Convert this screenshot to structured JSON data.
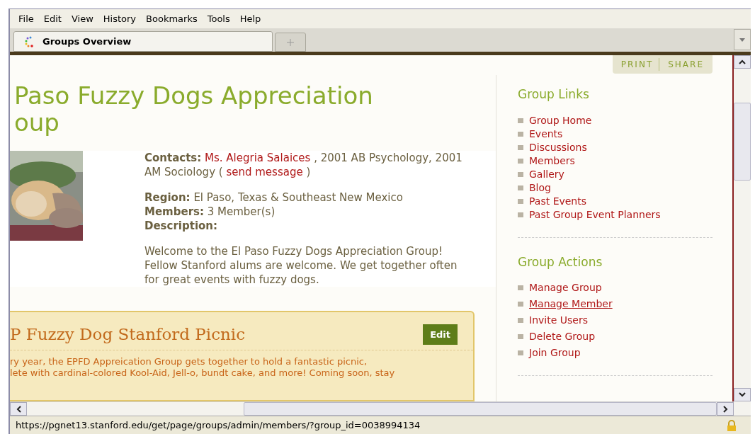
{
  "menu": [
    "File",
    "Edit",
    "View",
    "History",
    "Bookmarks",
    "Tools",
    "Help"
  ],
  "tabs": [
    {
      "label": "Groups Overview",
      "selected": true
    }
  ],
  "page_tools": [
    "PRINT",
    "SHARE"
  ],
  "group": {
    "title_lines": [
      "Paso Fuzzy Dogs Appreciation",
      "oup"
    ],
    "contacts": {
      "label": "Contacts:",
      "name": "Ms. Alegria Salaices",
      "middle": ", 2001 AB Psychology, 2001 AM Sociology (",
      "link": "send message",
      "end": ")"
    },
    "region": {
      "label": "Region:",
      "value": "El Paso, Texas & Southeast New Mexico"
    },
    "members": {
      "label": "Members:",
      "value": "3 Member(s)"
    },
    "description_label": "Description:",
    "description": "Welcome to the El Paso Fuzzy Dogs Appreciation Group! Fellow Stanford alums are welcome. We get together often for great events with fuzzy dogs."
  },
  "event": {
    "title": "P Fuzzy Dog Stanford Picnic",
    "button": "Edit",
    "lines": [
      "ry year, the EPFD Appreication Group gets together to hold a fantastic picnic,",
      "lete with cardinal-colored Kool-Aid, Jell-o, bundt cake, and more! Coming soon, stay"
    ]
  },
  "sidebar": [
    {
      "title": "Group Links",
      "items": [
        {
          "label": "Group Home",
          "hovered": false
        },
        {
          "label": "Events",
          "hovered": false
        },
        {
          "label": "Discussions",
          "hovered": false
        },
        {
          "label": "Members",
          "hovered": false
        },
        {
          "label": "Gallery",
          "hovered": false
        },
        {
          "label": "Blog",
          "hovered": false
        },
        {
          "label": "Past Events",
          "hovered": false
        },
        {
          "label": "Past Group Event Planners",
          "hovered": false
        }
      ]
    },
    {
      "title": "Group Actions",
      "items": [
        {
          "label": "Manage Group",
          "hovered": false
        },
        {
          "label": "Manage Member",
          "hovered": true
        },
        {
          "label": "Invite Users",
          "hovered": false
        },
        {
          "label": "Delete Group",
          "hovered": false
        },
        {
          "label": "Join Group",
          "hovered": false
        }
      ]
    }
  ],
  "status_bar": {
    "url": "https://pgnet13.stanford.edu/get/page/groups/admin/members/?group_id=0038994134"
  }
}
